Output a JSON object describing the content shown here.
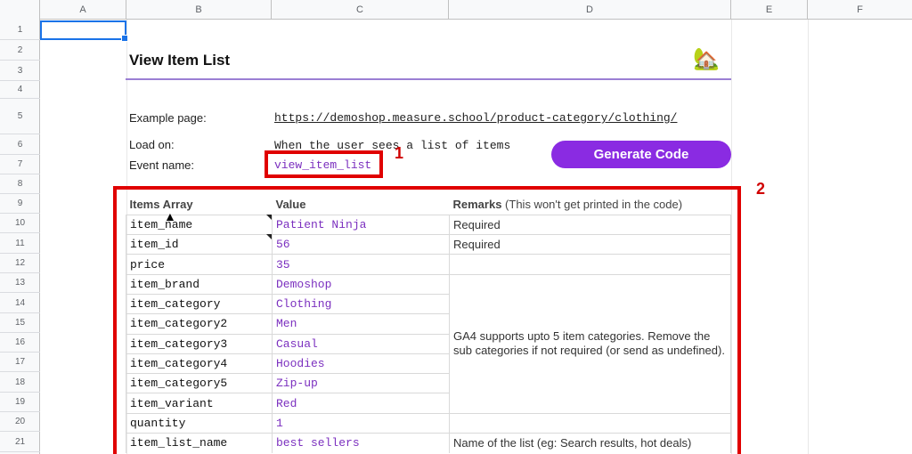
{
  "columns": [
    "A",
    "B",
    "C",
    "D",
    "E",
    "F"
  ],
  "rows": [
    "1",
    "2",
    "3",
    "4",
    "5",
    "6",
    "7",
    "8",
    "9",
    "10",
    "11",
    "12",
    "13",
    "14",
    "15",
    "16",
    "17",
    "18",
    "19",
    "20",
    "21"
  ],
  "page_title": "View Item List",
  "house_icon": "🏡",
  "fields": {
    "example_label": "Example page:",
    "example_url": "https://demoshop.measure.school/product-category/clothing/",
    "load_label": "Load on:",
    "load_value": "When the user sees a list of items",
    "event_label": "Event name:",
    "event_value": "view_item_list"
  },
  "badges": {
    "one": "1",
    "two": "2"
  },
  "generate_button": "Generate Code",
  "table": {
    "headers": {
      "items_array": "Items Array",
      "value": "Value",
      "remarks_bold": "Remarks",
      "remarks_note": " (This won't get printed in the code)"
    },
    "rows": [
      {
        "name": "item_name",
        "value": "Patient Ninja",
        "remark": "Required"
      },
      {
        "name": "item_id",
        "value": "56",
        "remark": "Required"
      },
      {
        "name": "price",
        "value": "35",
        "remark": ""
      },
      {
        "name": "item_brand",
        "value": "Demoshop",
        "remark": ""
      },
      {
        "name": "item_category",
        "value": "Clothing",
        "remark": ""
      },
      {
        "name": "item_category2",
        "value": "Men",
        "remark": ""
      },
      {
        "name": "item_category3",
        "value": "Casual",
        "remark": ""
      },
      {
        "name": "item_category4",
        "value": "Hoodies",
        "remark": ""
      },
      {
        "name": "item_category5",
        "value": "Zip-up",
        "remark": ""
      },
      {
        "name": "item_variant",
        "value": "Red",
        "remark": ""
      },
      {
        "name": "quantity",
        "value": "1",
        "remark": ""
      },
      {
        "name": "item_list_name",
        "value": "best sellers",
        "remark": "Name of the list (eg: Search results, hot deals)"
      }
    ],
    "category_remark": "GA4 supports upto 5 item categories. Remove the sub categories if not required (or send as undefined)."
  },
  "colors": {
    "accent_purple": "#8a2be2",
    "highlight_red": "#e00000",
    "value_purple": "#7b2fbf"
  }
}
